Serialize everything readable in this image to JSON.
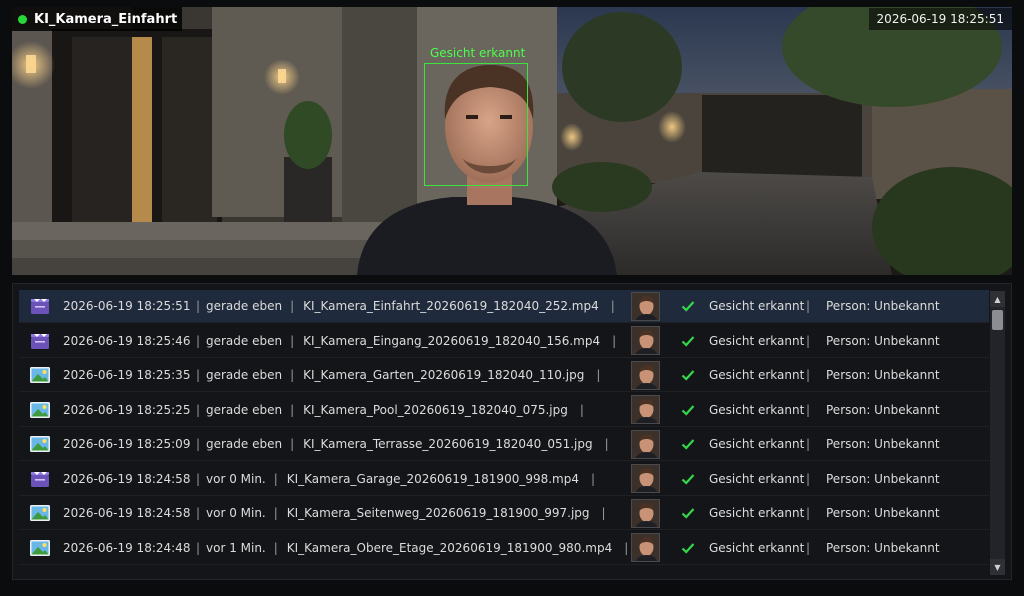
{
  "camera": {
    "name": "KI_Kamera_Einfahrt",
    "timestamp": "2026-06-19 18:25:51",
    "detection_label": "Gesicht erkannt",
    "status_color": "#27d83a"
  },
  "events": [
    {
      "type": "video-icon",
      "timestamp": "2026-06-19 18:25:51",
      "relative": "gerade eben",
      "file": "KI_Kamera_Einfahrt_20260619_182040_252.mp4",
      "detection": "Gesicht erkannt",
      "person": "Person: Unbekannt",
      "selected": true
    },
    {
      "type": "video-icon",
      "timestamp": "2026-06-19 18:25:46",
      "relative": "gerade eben",
      "file": "KI_Kamera_Eingang_20260619_182040_156.mp4",
      "detection": "Gesicht erkannt",
      "person": "Person: Unbekannt"
    },
    {
      "type": "image-icon",
      "timestamp": "2026-06-19 18:25:35",
      "relative": "gerade eben",
      "file": "KI_Kamera_Garten_20260619_182040_110.jpg",
      "detection": "Gesicht erkannt",
      "person": "Person: Unbekannt"
    },
    {
      "type": "image-icon",
      "timestamp": "2026-06-19 18:25:25",
      "relative": "gerade eben",
      "file": "KI_Kamera_Pool_20260619_182040_075.jpg",
      "detection": "Gesicht erkannt",
      "person": "Person: Unbekannt"
    },
    {
      "type": "image-icon",
      "timestamp": "2026-06-19 18:25:09",
      "relative": "gerade eben",
      "file": "KI_Kamera_Terrasse_20260619_182040_051.jpg",
      "detection": "Gesicht erkannt",
      "person": "Person: Unbekannt"
    },
    {
      "type": "video-icon",
      "timestamp": "2026-06-19 18:24:58",
      "relative": "vor 0 Min.",
      "file": "KI_Kamera_Garage_20260619_181900_998.mp4",
      "detection": "Gesicht erkannt",
      "person": "Person: Unbekannt"
    },
    {
      "type": "image-icon",
      "timestamp": "2026-06-19 18:24:58",
      "relative": "vor 0 Min.",
      "file": "KI_Kamera_Seitenweg_20260619_181900_997.jpg",
      "detection": "Gesicht erkannt",
      "person": "Person: Unbekannt"
    },
    {
      "type": "image-icon",
      "timestamp": "2026-06-19 18:24:48",
      "relative": "vor 1 Min.",
      "file": "KI_Kamera_Obere_Etage_20260619_181900_980.mp4",
      "detection": "Gesicht erkannt",
      "person": "Person: Unbekannt"
    }
  ],
  "separator": "|",
  "scroll": {
    "up": "▲",
    "down": "▼"
  },
  "colors": {
    "check": "#36d64a",
    "selected_row": "#1f2a3c",
    "face_box": "#3ee43e"
  }
}
